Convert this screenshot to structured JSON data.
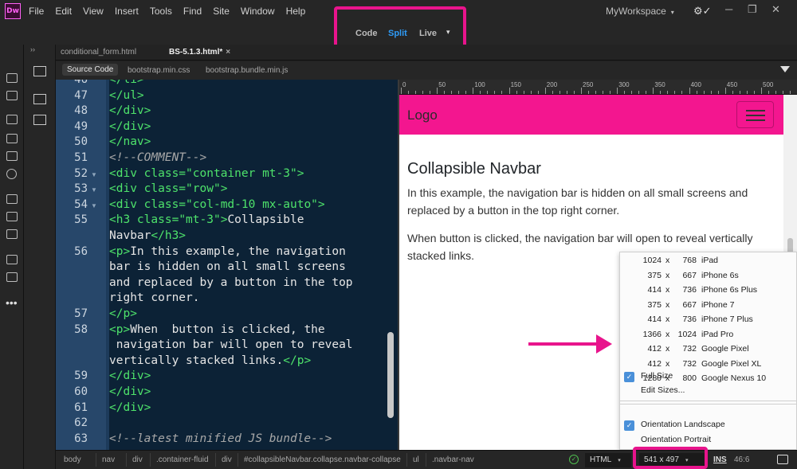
{
  "app": {
    "logo": "Dw"
  },
  "menu": [
    "File",
    "Edit",
    "View",
    "Insert",
    "Tools",
    "Find",
    "Site",
    "Window",
    "Help"
  ],
  "workspace": {
    "label": "MyWorkspace",
    "caret": "▾"
  },
  "views": {
    "code": "Code",
    "split": "Split",
    "live": "Live",
    "caret": "▾"
  },
  "left_tools": [
    "file-icon",
    "sync-icon",
    "code-view-icon",
    "properties-icon",
    "align-icon",
    "target-icon",
    "snippets-icon",
    "css-icon",
    "brush-icon",
    "comment-icon",
    "checklist-icon",
    "more-icon"
  ],
  "doc_tabs": [
    {
      "label": "conditional_form.html",
      "active": false
    },
    {
      "label": "BS-5.1.3.html*",
      "active": true,
      "close": "×"
    }
  ],
  "expander": "››",
  "related_files": [
    {
      "label": "Source Code",
      "active": true
    },
    {
      "label": "bootstrap.min.css",
      "active": false
    },
    {
      "label": "bootstrap.bundle.min.js",
      "active": false
    }
  ],
  "code_lines": [
    {
      "num": "46",
      "fold": false,
      "html": "<span class=\"tg\">&lt;/li&gt;</span>"
    },
    {
      "num": "47",
      "fold": false,
      "html": "<span class=\"tg\">&lt;/ul&gt;</span>"
    },
    {
      "num": "48",
      "fold": false,
      "html": "<span class=\"tg\">&lt;/div&gt;</span>"
    },
    {
      "num": "49",
      "fold": false,
      "html": "<span class=\"tg\">&lt;/div&gt;</span>"
    },
    {
      "num": "50",
      "fold": false,
      "html": "<span class=\"tg\">&lt;/nav&gt;</span>"
    },
    {
      "num": "51",
      "fold": false,
      "html": "<span class=\"cm\">&lt;!--COMMENT--&gt;</span>"
    },
    {
      "num": "52",
      "fold": true,
      "html": "<span class=\"tg\">&lt;div </span><span class=\"at\">class=</span><span class=\"av\">\"container mt-3\"</span><span class=\"tg\">&gt;</span>"
    },
    {
      "num": "53",
      "fold": true,
      "html": "<span class=\"tg\">&lt;div </span><span class=\"at\">class=</span><span class=\"av\">\"row\"</span><span class=\"tg\">&gt;</span>"
    },
    {
      "num": "54",
      "fold": true,
      "html": "<span class=\"tg\">&lt;div </span><span class=\"at\">class=</span><span class=\"av\">\"col-md-10 mx-auto\"</span><span class=\"tg\">&gt;</span>"
    },
    {
      "num": "55",
      "fold": false,
      "html": "<span class=\"tg\">&lt;h3 </span><span class=\"at\">class=</span><span class=\"av\">\"mt-3\"</span><span class=\"tg\">&gt;</span>Collapsible"
    },
    {
      "num": "",
      "fold": false,
      "html": "Navbar<span class=\"tg\">&lt;/h3&gt;</span>"
    },
    {
      "num": "56",
      "fold": false,
      "html": "<span class=\"tg\">&lt;p&gt;</span>In this example, the navigation"
    },
    {
      "num": "",
      "fold": false,
      "html": "bar is hidden on all small screens"
    },
    {
      "num": "",
      "fold": false,
      "html": "and replaced by a button in the top"
    },
    {
      "num": "",
      "fold": false,
      "html": "right corner."
    },
    {
      "num": "57",
      "fold": false,
      "html": "<span class=\"tg\">&lt;/p&gt;</span>"
    },
    {
      "num": "58",
      "fold": false,
      "html": "<span class=\"tg\">&lt;p&gt;</span>When  button is clicked, the"
    },
    {
      "num": "",
      "fold": false,
      "html": " navigation bar will open to reveal"
    },
    {
      "num": "",
      "fold": false,
      "html": "vertically stacked links.<span class=\"tg\">&lt;/p&gt;</span>"
    },
    {
      "num": "59",
      "fold": false,
      "html": "<span class=\"tg\">&lt;/div&gt;</span>"
    },
    {
      "num": "60",
      "fold": false,
      "html": "<span class=\"tg\">&lt;/div&gt;</span>"
    },
    {
      "num": "61",
      "fold": false,
      "html": "<span class=\"tg\">&lt;/div&gt;</span>"
    },
    {
      "num": "62",
      "fold": false,
      "html": ""
    },
    {
      "num": "63",
      "fold": false,
      "html": "<span class=\"cm\">&lt;!--latest minified JS bundle--&gt;</span>"
    }
  ],
  "ruler": [
    "0",
    "50",
    "100",
    "150",
    "200",
    "250",
    "300",
    "350",
    "400",
    "450",
    "500"
  ],
  "live": {
    "logo": "Logo",
    "heading": "Collapsible Navbar",
    "para1": "In this example, the navigation bar is hidden on all small screens and replaced by a button in the top right corner.",
    "para2": "When button is clicked, the navigation bar will open to reveal vertically stacked links."
  },
  "sizes": [
    {
      "w": "1024",
      "x": "x",
      "h": "768",
      "name": "iPad"
    },
    {
      "w": "375",
      "x": "x",
      "h": "667",
      "name": "iPhone 6s"
    },
    {
      "w": "414",
      "x": "x",
      "h": "736",
      "name": "iPhone 6s Plus"
    },
    {
      "w": "375",
      "x": "x",
      "h": "667",
      "name": "iPhone 7"
    },
    {
      "w": "414",
      "x": "x",
      "h": "736",
      "name": "iPhone 7 Plus"
    },
    {
      "w": "1366",
      "x": "x",
      "h": "1024",
      "name": "iPad Pro"
    },
    {
      "w": "412",
      "x": "x",
      "h": "732",
      "name": "Google Pixel"
    },
    {
      "w": "412",
      "x": "x",
      "h": "732",
      "name": "Google Pixel XL"
    },
    {
      "w": "1280",
      "x": "x",
      "h": "800",
      "name": "Google Nexus 10"
    }
  ],
  "size_options": {
    "full_size": "Full Size",
    "edit_sizes": "Edit Sizes...",
    "landscape": "Orientation Landscape",
    "portrait": "Orientation Portrait",
    "check": "✓"
  },
  "breadcrumbs": [
    "body",
    "nav",
    "div",
    ".container-fluid",
    "div",
    "#collapsibleNavbar.collapse.navbar-collapse",
    "ul",
    ".navbar-nav"
  ],
  "status": {
    "doc_type": "HTML",
    "window_size": "541 x 497",
    "ins": "INS",
    "cursor": "46:6",
    "caret": "▾"
  },
  "colors": {
    "accent": "#2e9bf7",
    "highlight": "#e8148c",
    "navbar": "#f3168f",
    "code_bg": "#0c2236"
  }
}
